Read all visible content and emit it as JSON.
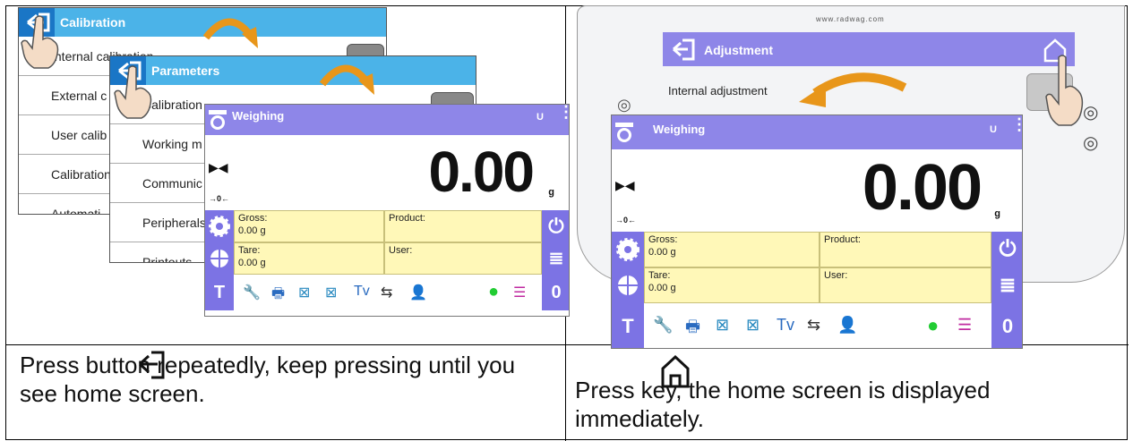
{
  "left_panel": {
    "calibration": {
      "title": "Calibration",
      "rows": [
        "Internal calibration",
        "External c",
        "User calib",
        "Calibration",
        "Automati"
      ]
    },
    "parameters": {
      "title": "Parameters",
      "rows": [
        "Calibration",
        "Working m",
        "Communic",
        "Peripherals",
        "Printouts"
      ]
    },
    "weighing": {
      "title": "Weighing",
      "status_icons": "U",
      "value": "0.00",
      "unit": "g",
      "zero_marker": "→0←",
      "cells": {
        "gross_label": "Gross:",
        "gross_value": "0.00 g",
        "product_label": "Product:",
        "tare_label": "Tare:",
        "tare_value": "0.00 g",
        "user_label": "User:"
      },
      "side_t": "T",
      "side_zero": "0"
    },
    "caption": "Press      button repeatedly, keep pressing until you see home screen."
  },
  "right_panel": {
    "website": "www.radwag.com",
    "adjustment": {
      "title": "Adjustment",
      "row": "Internal adjustment"
    },
    "weighing": {
      "title": "Weighing",
      "status_icons": "U",
      "value": "0.00",
      "unit": "g",
      "zero_marker": "→0←",
      "cells": {
        "gross_label": "Gross:",
        "gross_value": "0.00 g",
        "product_label": "Product:",
        "tare_label": "Tare:",
        "tare_value": "0.00 g",
        "user_label": "User:"
      },
      "side_t": "T",
      "side_zero": "0"
    },
    "caption": "Press      key, the home screen is displayed immediately."
  },
  "colors": {
    "calibration_bar": "#4bb3e8",
    "back_button": "#1a76c6",
    "weighing_bar": "#8e86e8",
    "side_buttons": "#7c73e4",
    "info_cells": "#fff8b8",
    "arrow": "#f0a020"
  }
}
